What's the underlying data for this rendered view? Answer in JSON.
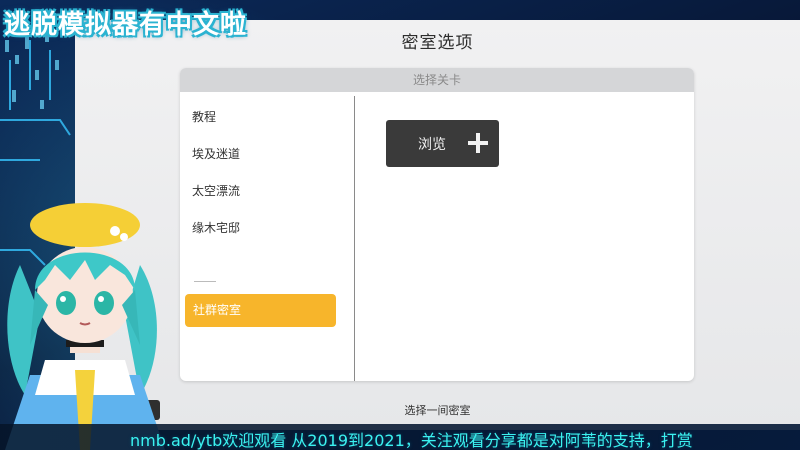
{
  "stream": {
    "title": "逃脱模拟器有中文啦",
    "ticker": "nmb.ad/ytb欢迎观看 从2019到2021，关注观看分享都是对阿苇的支持，打赏"
  },
  "game": {
    "window_title": "密室选项",
    "panel_header": "选择关卡",
    "levels": [
      "教程",
      "埃及迷道",
      "太空漂流",
      "缘木宅邸"
    ],
    "selected_level": "社群密室",
    "browse_label": "浏览",
    "footer": "选择一间密室"
  },
  "colors": {
    "accent": "#f7b52b",
    "browse_bg": "#3a3a3a",
    "ticker_text": "#3bf2f0"
  },
  "icons": [
    "plus-icon"
  ]
}
